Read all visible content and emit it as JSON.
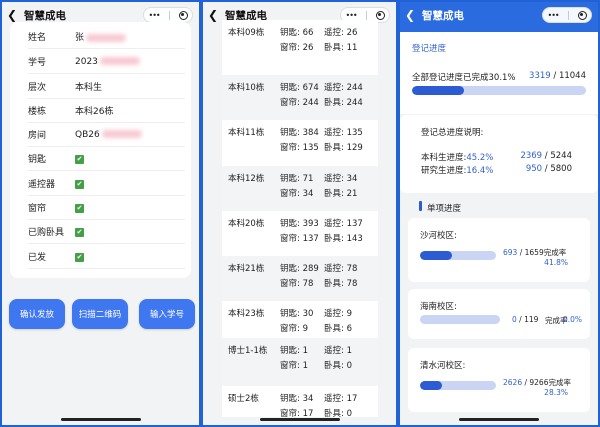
{
  "app_title": "智慧成电",
  "student": {
    "rows": [
      {
        "label": "姓名",
        "value": "张",
        "blurred": true
      },
      {
        "label": "学号",
        "value": "2023",
        "blurred": true
      },
      {
        "label": "层次",
        "value": "本科生"
      },
      {
        "label": "楼栋",
        "value": "本科26栋"
      },
      {
        "label": "房间",
        "value": "QB26",
        "blurred": true
      },
      {
        "label": "钥匙",
        "check": true
      },
      {
        "label": "遥控器",
        "check": true
      },
      {
        "label": "窗帘",
        "check": true
      },
      {
        "label": "已购卧具",
        "check": true
      },
      {
        "label": "已发",
        "check": true
      }
    ],
    "buttons": [
      "确认发放",
      "扫描二维码",
      "输入学号"
    ]
  },
  "buildings": [
    {
      "name": "本科09栋",
      "key": "钥匙: 66",
      "remote": "遥控: 26",
      "curtain": "窗帘: 26",
      "bedding": "卧具: 11"
    },
    {
      "name": "本科10栋",
      "key": "钥匙: 674",
      "remote": "遥控: 244",
      "curtain": "窗帘: 244",
      "bedding": "卧具: 244"
    },
    {
      "name": "本科11栋",
      "key": "钥匙: 384",
      "remote": "遥控: 135",
      "curtain": "窗帘: 135",
      "bedding": "卧具: 129"
    },
    {
      "name": "本科12栋",
      "key": "钥匙: 71",
      "remote": "遥控: 34",
      "curtain": "窗帘: 34",
      "bedding": "卧具: 21"
    },
    {
      "name": "本科20栋",
      "key": "钥匙: 393",
      "remote": "遥控: 137",
      "curtain": "窗帘: 137",
      "bedding": "卧具: 143"
    },
    {
      "name": "本科21栋",
      "key": "钥匙: 289",
      "remote": "遥控: 78",
      "curtain": "窗帘: 78",
      "bedding": "卧具: 78"
    },
    {
      "name": "本科23栋",
      "key": "钥匙: 30",
      "remote": "遥控: 9",
      "curtain": "窗帘: 9",
      "bedding": "卧具: 6"
    },
    {
      "name": "博士1-1栋",
      "key": "钥匙: 1",
      "remote": "遥控: 1",
      "curtain": "窗帘: 1",
      "bedding": "卧具: 0"
    },
    {
      "name": "硕士2栋",
      "key": "钥匙: 34",
      "remote": "遥控: 17",
      "curtain": "窗帘: 17",
      "bedding": "卧具: 0"
    }
  ],
  "progress": {
    "header": "登记进度",
    "overall_label": "全部登记进度已完成30.1%",
    "overall_done": "3319",
    "overall_total": " / 11044",
    "overall_fraction": 0.301,
    "desc_title": "登记总进度说明:",
    "undergrad_label": "本科生进度:",
    "undergrad_pct": "45.2%",
    "undergrad_done": "2369",
    "undergrad_total": " / 5244",
    "grad_label": "研究生进度:",
    "grad_pct": "16.4%",
    "grad_done": "950",
    "grad_total": " / 5800",
    "section_title": "单项进度",
    "campuses": [
      {
        "name": "沙河校区:",
        "done": "693",
        "total": " / 1659",
        "rate_label": "完成率",
        "rate": "41.8%",
        "fraction": 0.418
      },
      {
        "name": "海南校区:",
        "done": "0",
        "total": " / 119",
        "rate_label": "完成率",
        "rate": "0.0%",
        "fraction": 0.0
      },
      {
        "name": "清水河校区:",
        "done": "2626",
        "total": " / 9266",
        "rate_label": "完成率",
        "rate": "28.3%",
        "fraction": 0.283
      }
    ]
  },
  "colors": {
    "accent": "#3f77f0",
    "bar_fill": "#2d5bd3",
    "bar_track": "#c9d5f3",
    "success": "#43a047"
  },
  "icons": {
    "back": "chevron-left-icon",
    "more": "more-dots-icon",
    "record": "record-icon",
    "check": "check-box-icon"
  }
}
